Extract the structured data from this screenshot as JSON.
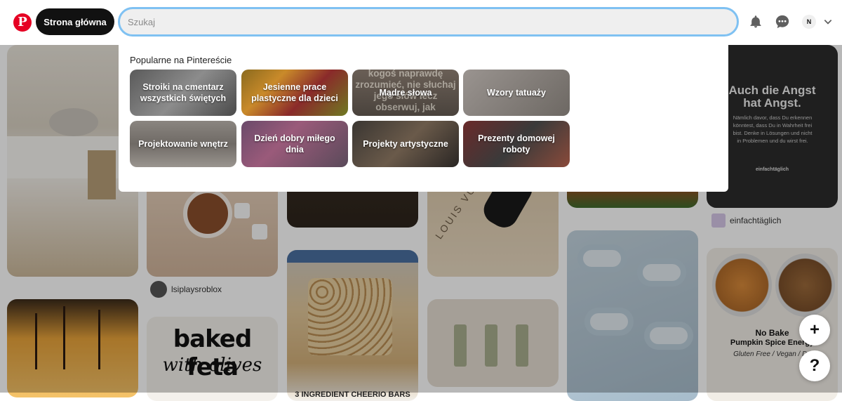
{
  "header": {
    "logo_letter": "P",
    "home_label": "Strona główna",
    "search_placeholder": "Szukaj",
    "avatar_initial": "N",
    "brand_color": "#e60023"
  },
  "dropdown": {
    "title": "Popularne na Pintereście",
    "tiles": [
      {
        "label": "Stroiki na cmentarz wszystkich świętych"
      },
      {
        "label": "Jesienne prace plastyczne dla dzieci"
      },
      {
        "label": "Mądre słowa",
        "background_text": "kogoś naprawdę zrozumieć, nie słuchaj jego słów lecz obserwuj, jak"
      },
      {
        "label": "Wzory tatuaży"
      },
      {
        "label": "Projektowanie wnętrz"
      },
      {
        "label": "Dzień dobry miłego dnia"
      },
      {
        "label": "Projekty artystyczne"
      },
      {
        "label": "Prezenty domowej roboty"
      }
    ]
  },
  "feed": {
    "pins": [
      {
        "text": "Auch die Angst hat Angst.",
        "subtext": "Nämlich davor, dass Du erkennen könntest, dass Du in Wahrheit frei bist. Denke in Lösungen und nicht in Problemen und du wirst frei.",
        "brand": "einfachtäglich"
      },
      {
        "text": "LOUIS VUITTON"
      },
      {
        "text_line1": "baked feta",
        "text_line2": "with olives"
      },
      {
        "text": "3 INGREDIENT CHEERIO BARS"
      },
      {
        "text_line1": "No Bake",
        "text_line2": "Pumpkin Spice Energy",
        "text_line3": "Gluten Free / Vegan / Da"
      }
    ],
    "captions": [
      {
        "name": "lsiplaysroblox"
      },
      {
        "name": "einfachtäglich"
      }
    ]
  },
  "fab": {
    "add_label": "+",
    "help_label": "?"
  }
}
